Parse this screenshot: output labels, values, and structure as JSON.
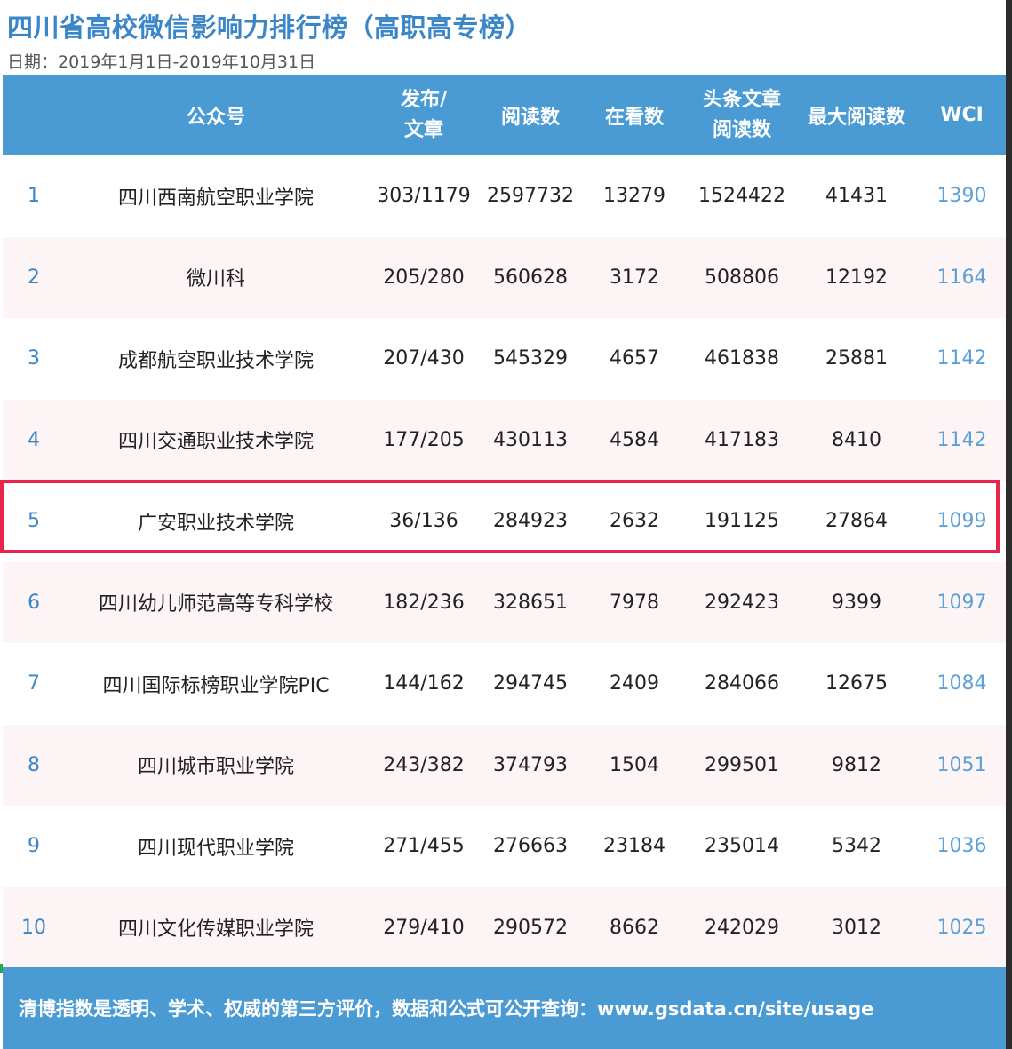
{
  "title": "四川省高校微信影响力排行榜（高职高专榜）",
  "date": "日期：2019年1月1日-2019年10月31日",
  "headers": {
    "rank": "",
    "name": "公众号",
    "post_line1": "发布/",
    "post_line2": "文章",
    "read": "阅读数",
    "looking": "在看数",
    "headline_line1": "头条文章",
    "headline_line2": "阅读数",
    "max_read": "最大阅读数",
    "wci": "WCI"
  },
  "rows": [
    {
      "rank": "1",
      "name": "四川西南航空职业学院",
      "post": "303/1179",
      "read": "2597732",
      "looking": "13279",
      "headline": "1524422",
      "max_read": "41431",
      "wci": "1390"
    },
    {
      "rank": "2",
      "name": "微川科",
      "post": "205/280",
      "read": "560628",
      "looking": "3172",
      "headline": "508806",
      "max_read": "12192",
      "wci": "1164"
    },
    {
      "rank": "3",
      "name": "成都航空职业技术学院",
      "post": "207/430",
      "read": "545329",
      "looking": "4657",
      "headline": "461838",
      "max_read": "25881",
      "wci": "1142"
    },
    {
      "rank": "4",
      "name": "四川交通职业技术学院",
      "post": "177/205",
      "read": "430113",
      "looking": "4584",
      "headline": "417183",
      "max_read": "8410",
      "wci": "1142"
    },
    {
      "rank": "5",
      "name": "广安职业技术学院",
      "post": "36/136",
      "read": "284923",
      "looking": "2632",
      "headline": "191125",
      "max_read": "27864",
      "wci": "1099"
    },
    {
      "rank": "6",
      "name": "四川幼儿师范高等专科学校",
      "post": "182/236",
      "read": "328651",
      "looking": "7978",
      "headline": "292423",
      "max_read": "9399",
      "wci": "1097"
    },
    {
      "rank": "7",
      "name": "四川国际标榜职业学院PIC",
      "post": "144/162",
      "read": "294745",
      "looking": "2409",
      "headline": "284066",
      "max_read": "12675",
      "wci": "1084"
    },
    {
      "rank": "8",
      "name": "四川城市职业学院",
      "post": "243/382",
      "read": "374793",
      "looking": "1504",
      "headline": "299501",
      "max_read": "9812",
      "wci": "1051"
    },
    {
      "rank": "9",
      "name": "四川现代职业学院",
      "post": "271/455",
      "read": "276663",
      "looking": "23184",
      "headline": "235014",
      "max_read": "5342",
      "wci": "1036"
    },
    {
      "rank": "10",
      "name": "四川文化传媒职业学院",
      "post": "279/410",
      "read": "290572",
      "looking": "8662",
      "headline": "242029",
      "max_read": "3012",
      "wci": "1025"
    }
  ],
  "highlighted_rank": "5",
  "footer": "清博指数是透明、学术、权威的第三方评价，数据和公式可公开查询：www.gsdata.cn/site/usage",
  "colors": {
    "title": "#3a86c8",
    "header_bg": "#4a9ad4",
    "alt_row_bg": "#fcf4f5",
    "highlight_border": "#e8254a",
    "wci_text": "#5ba0d8"
  }
}
